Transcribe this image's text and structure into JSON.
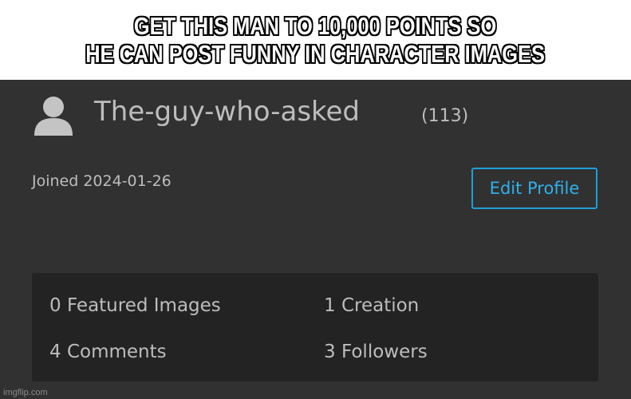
{
  "caption": {
    "line1": "GET THIS MAN TO 10,000 POINTS SO",
    "line2": "HE CAN POST FUNNY IN CHARACTER IMAGES"
  },
  "profile": {
    "avatar_icon": "user-silhouette-icon",
    "username": "The-guy-who-asked",
    "points": "(113)",
    "joined": "Joined 2024-01-26",
    "edit_button": "Edit Profile",
    "accent_color": "#1f9ed8",
    "stats": [
      "0 Featured Images",
      "1 Creation",
      "4 Comments",
      "3 Followers"
    ]
  },
  "watermark": "imgflip.com"
}
